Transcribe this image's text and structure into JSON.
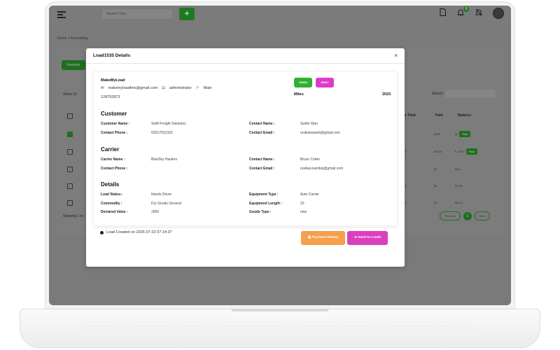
{
  "topbar": {
    "search_placeholder": "Search Here",
    "add_label": "+",
    "notification_count": "0"
  },
  "breadcrumb": "Home > Accounting",
  "background": {
    "tab_label": "Invoices",
    "show_label": "Show  10",
    "showing_label": "Showing 1 to",
    "search_label": "Search:",
    "columns": [
      "e Total",
      "Paid",
      "Balance"
    ],
    "rows": [
      {
        "total": "",
        "paid": "$350",
        "balance": "$0",
        "status": "Paid"
      },
      {
        "total": "0",
        "paid": "$9140",
        "balance": "$ -3570",
        "status": "Paid"
      },
      {
        "total": "",
        "paid": "$0",
        "balance": "$36",
        "status": ""
      },
      {
        "total": "0",
        "paid": "$0",
        "balance": "$1220",
        "status": ""
      },
      {
        "total": "0",
        "paid": "$0",
        "balance": "$9140",
        "status": ""
      }
    ],
    "pager": {
      "prev": "Previous",
      "page": "1",
      "next": "Next"
    }
  },
  "modal": {
    "title": "Load1535 Details",
    "close": "×",
    "company": {
      "name": "MakeMyLoad",
      "email": "makemyloadtms@gmail.com",
      "role": "administrator",
      "branch": "Main",
      "phone": "128752873"
    },
    "tags": [
      "60658",
      "80001"
    ],
    "miles_label": "Miles",
    "miles_value": "2023",
    "customer": {
      "title": "Customer",
      "name_label": "Customer Name :",
      "name": "Swift Freight Solutions",
      "phone_label": "Contact Phone :",
      "phone": "03317531323",
      "contact_label": "Contact Name :",
      "contact": "Swifer Man",
      "email_label": "Contact Email :",
      "email": "ravikawaweb@gmail.com"
    },
    "carrier": {
      "title": "Carrier",
      "name_label": "Carrier Name :",
      "name": "BlueSky Haulers",
      "phone_label": "Contact Phone :",
      "phone": "",
      "contact_label": "Contact Name :",
      "contact": "Bruce Cotter",
      "email_label": "Contact Email :",
      "email": "ravikas.kamboj@gmail.com"
    },
    "details": {
      "title": "Details",
      "status_label": "Load Status :",
      "status": "Needs Driver",
      "commodity_label": "Commodity :",
      "commodity": "Dry Goods General",
      "value_label": "Declared Value :",
      "value": "2000",
      "equipment_type_label": "Equipment Type :",
      "equipment_type": "Auto Carrier",
      "equipment_length_label": "Equipment Length :",
      "equipment_length": "20",
      "goods_type_label": "Goods Type :",
      "goods_type": "new"
    },
    "created_text": "Load Created on 2025-07-22 07:14:37",
    "payment_button": "Payment History",
    "send_button": "Send to Loads"
  }
}
